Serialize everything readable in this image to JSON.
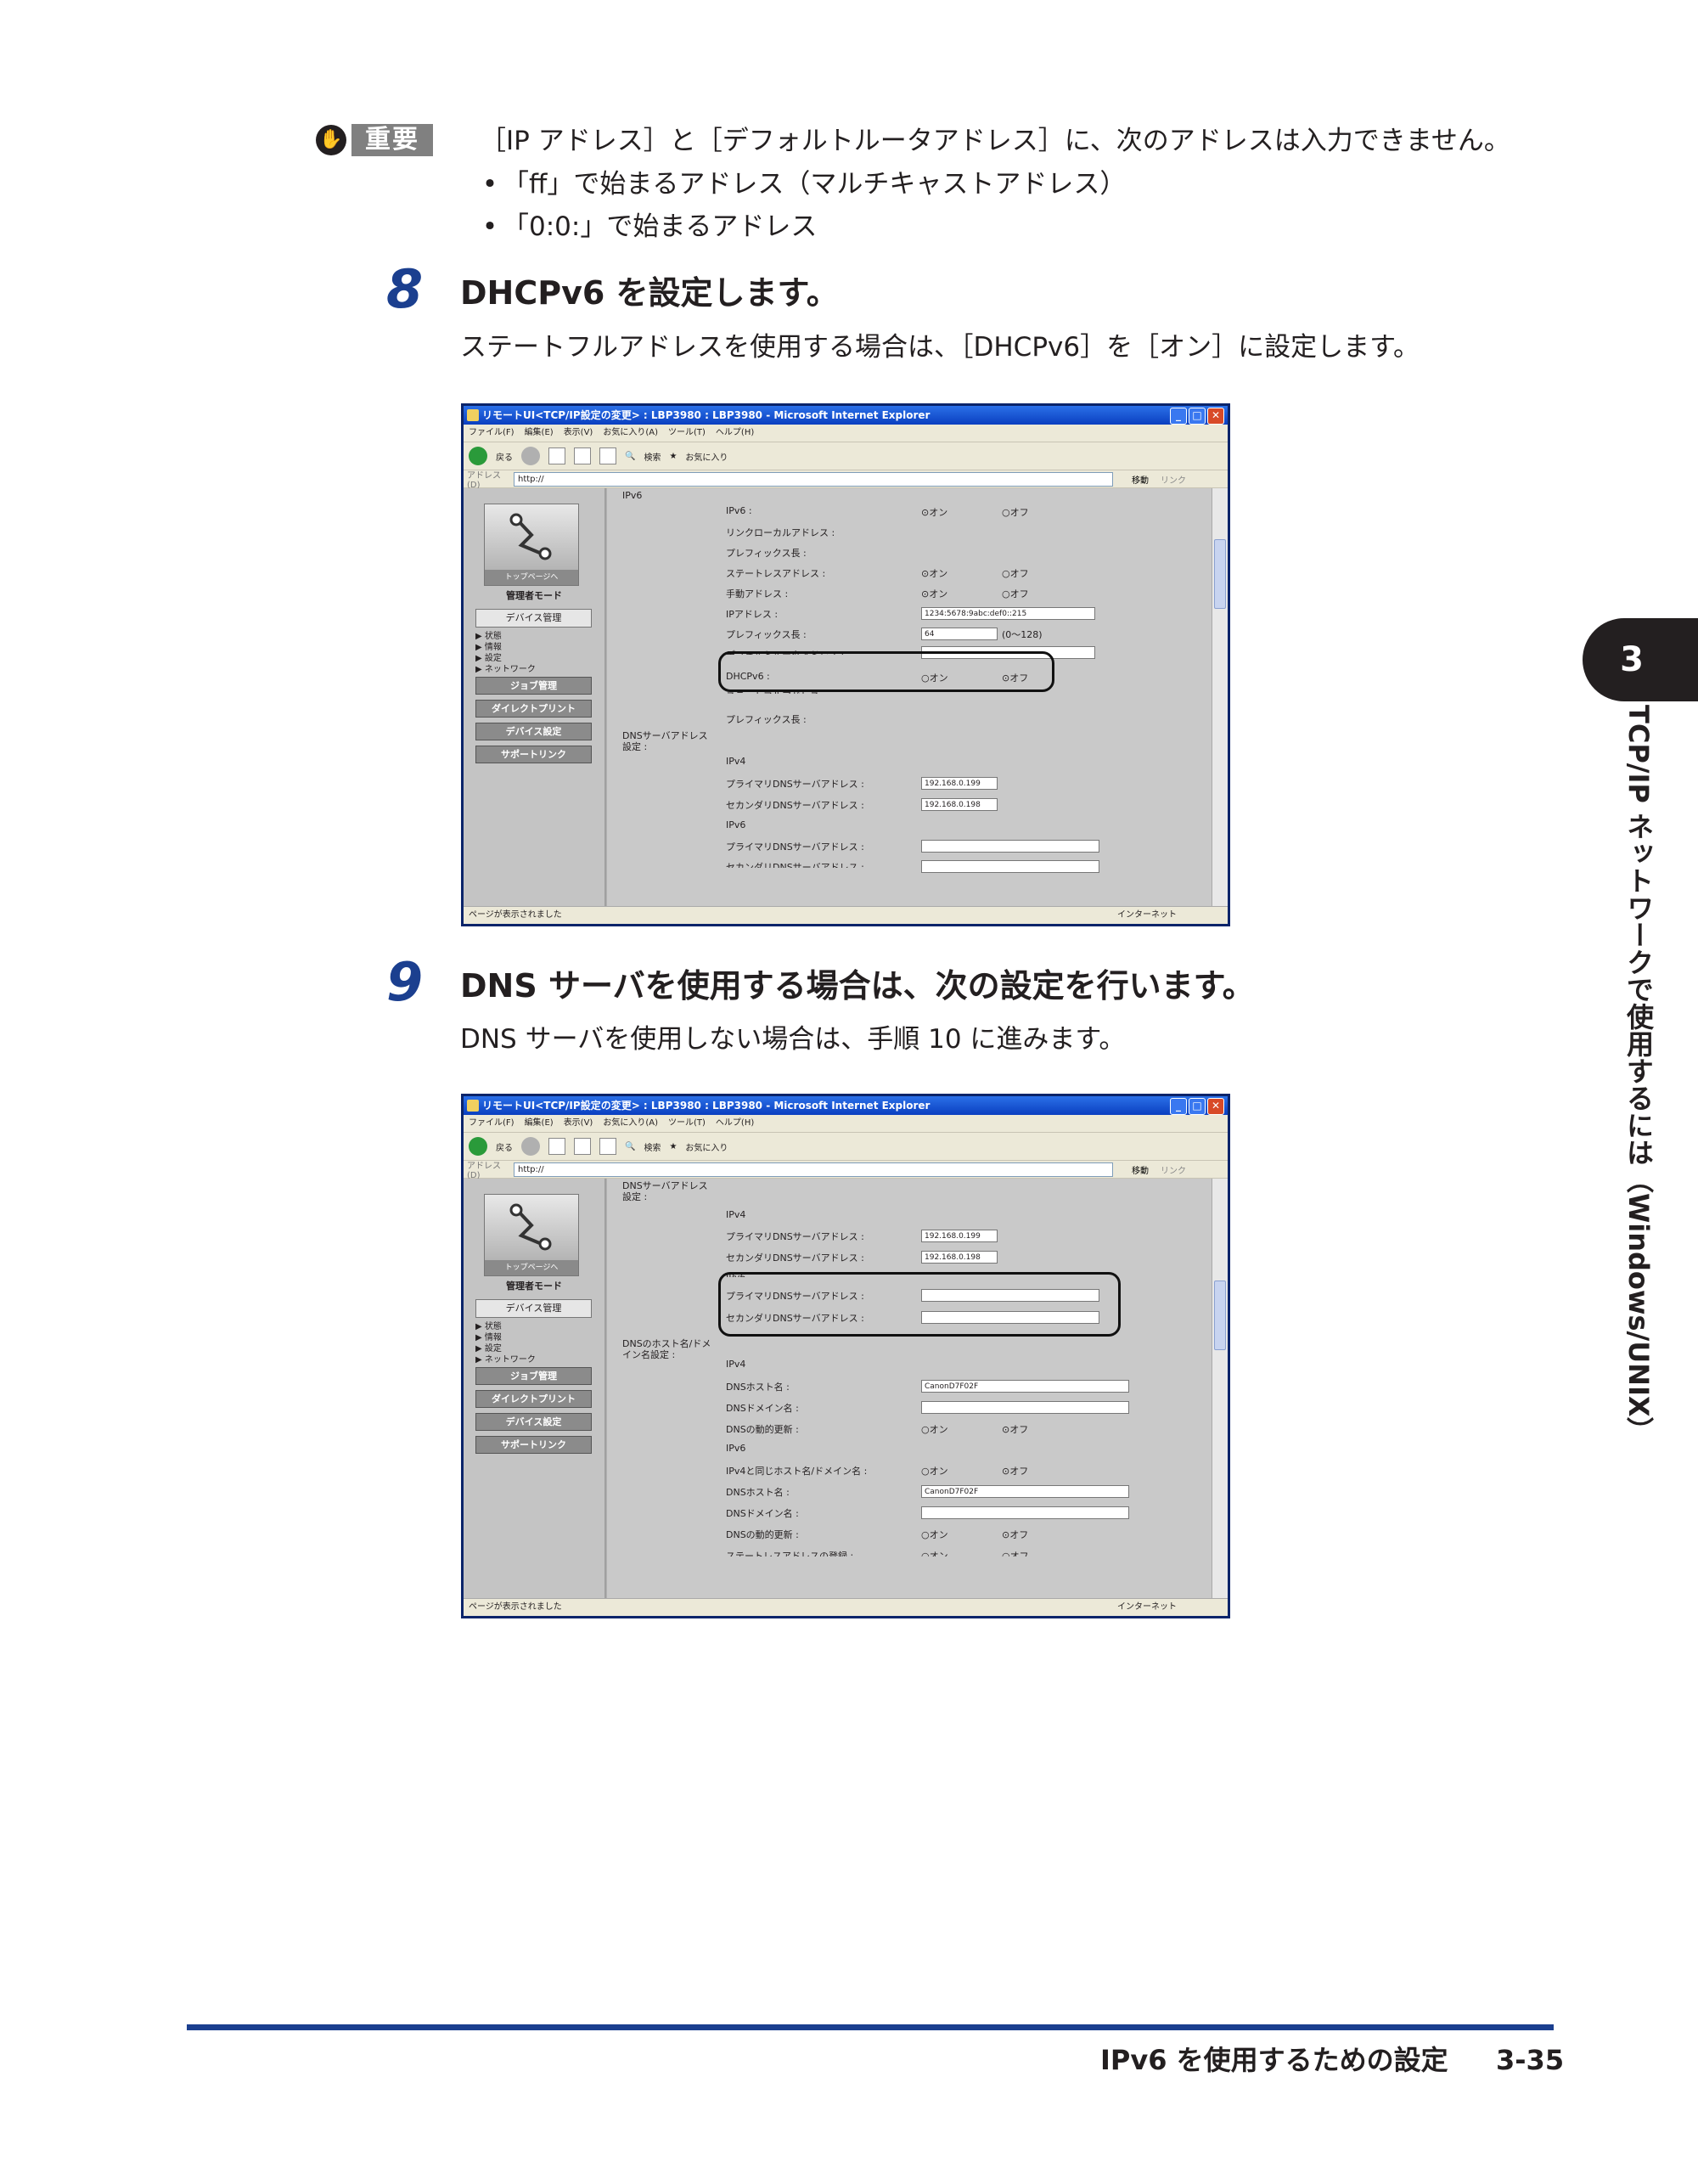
{
  "important": {
    "badge": "重要",
    "text": "［IP アドレス］と［デフォルトルータアドレス］に、次のアドレスは入力できません。",
    "bullets": [
      "「ff」で始まるアドレス（マルチキャストアドレス）",
      "「0:0:」で始まるアドレス"
    ]
  },
  "step8": {
    "num": "8",
    "title": "DHCPv6 を設定します。",
    "desc": "ステートフルアドレスを使用する場合は、［DHCPv6］を［オン］に設定します。"
  },
  "step9": {
    "num": "9",
    "title": "DNS サーバを使用する場合は、次の設定を行います。",
    "desc": "DNS サーバを使用しない場合は、手順 10 に進みます。"
  },
  "browser": {
    "title": "リモートUI<TCP/IP設定の変更> : LBP3980 : LBP3980 - Microsoft Internet Explorer",
    "menu": [
      "ファイル(F)",
      "編集(E)",
      "表示(V)",
      "お気に入り(A)",
      "ツール(T)",
      "ヘルプ(H)"
    ],
    "back": "戻る",
    "search": "検索",
    "favorites": "お気に入り",
    "address_label": "アドレス(D)",
    "address": "http://",
    "go": "移動",
    "links": "リンク",
    "status": "ページが表示されました",
    "zone": "インターネット",
    "sidebar": {
      "logo_caption": "トップページへ",
      "mode": "管理者モード",
      "device_button": "デバイス管理",
      "links": [
        "▶ 状態",
        "▶ 情報",
        "▶ 設定",
        "▶ ネットワーク"
      ],
      "buttons": [
        "ジョブ管理",
        "ダイレクトプリント",
        "デバイス設定",
        "サポートリンク"
      ]
    }
  },
  "shot1": {
    "section": "IPv6",
    "rows": [
      {
        "label": "IPv6 :",
        "on": "⊙オン",
        "off": "○オフ"
      },
      {
        "label": "リンクローカルアドレス :"
      },
      {
        "label": "プレフィックス長 :"
      },
      {
        "label": "ステートレスアドレス :",
        "on": "⊙オン",
        "off": "○オフ"
      },
      {
        "label": "手動アドレス :",
        "on": "⊙オン",
        "off": "○オフ"
      },
      {
        "label": "IPアドレス :",
        "value": "1234:5678:9abc:def0::215"
      },
      {
        "label": "プレフィックス長 :",
        "value": "64",
        "hint": "(0〜128)"
      },
      {
        "label": "デフォルトルータアドレス :"
      },
      {
        "label": "DHCPv6 :",
        "on": "○オン",
        "off": "⊙オフ"
      },
      {
        "label": "ステートフルアドレス :"
      },
      {
        "label": "プレフィックス長 :"
      }
    ],
    "dns_section": "DNSサーバアドレス設定 :",
    "ipv4": "IPv4",
    "primary_v4": {
      "label": "プライマリDNSサーバアドレス :",
      "value": "192.168.0.199"
    },
    "secondary_v4": {
      "label": "セカンダリDNSサーバアドレス :",
      "value": "192.168.0.198"
    },
    "ipv6": "IPv6",
    "primary_v6": {
      "label": "プライマリDNSサーバアドレス :"
    },
    "secondary_v6": {
      "label": "セカンダリDNSサーバアドレス :"
    }
  },
  "shot2": {
    "dns_section": "DNSサーバアドレス設定 :",
    "ipv4": "IPv4",
    "primary_v4": {
      "label": "プライマリDNSサーバアドレス :",
      "value": "192.168.0.199"
    },
    "secondary_v4": {
      "label": "セカンダリDNSサーバアドレス :",
      "value": "192.168.0.198"
    },
    "ipv6": "IPv6",
    "primary_v6": {
      "label": "プライマリDNSサーバアドレス :"
    },
    "secondary_v6": {
      "label": "セカンダリDNSサーバアドレス :"
    },
    "host_section": "DNSのホスト名/ドメイン名設定 :",
    "host_ipv4": "IPv4",
    "host_name": {
      "label": "DNSホスト名 :",
      "value": "CanonD7F02F"
    },
    "domain_name": {
      "label": "DNSドメイン名 :"
    },
    "dynamic": {
      "label": "DNSの動的更新 :",
      "on": "○オン",
      "off": "⊙オフ"
    },
    "host_ipv6": "IPv6",
    "same": {
      "label": "IPv4と同じホスト名/ドメイン名 :",
      "on": "○オン",
      "off": "⊙オフ"
    },
    "host_name6": {
      "label": "DNSホスト名 :",
      "value": "CanonD7F02F"
    },
    "domain_name6": {
      "label": "DNSドメイン名 :"
    },
    "dynamic6": {
      "label": "DNSの動的更新 :",
      "on": "○オン",
      "off": "⊙オフ"
    },
    "stateless_reg": {
      "label": "ステートレスアドレスの登録 :",
      "on": "○オン",
      "off": "○オフ"
    }
  },
  "chapter": {
    "num": "3",
    "title": "TCP/IP ネットワークで使用するには（Windows/UNIX）"
  },
  "footer": {
    "title": "IPv6 を使用するための設定",
    "page": "3-35"
  },
  "colors": {
    "accent": "#1b3f8f",
    "badge": "#808080"
  }
}
